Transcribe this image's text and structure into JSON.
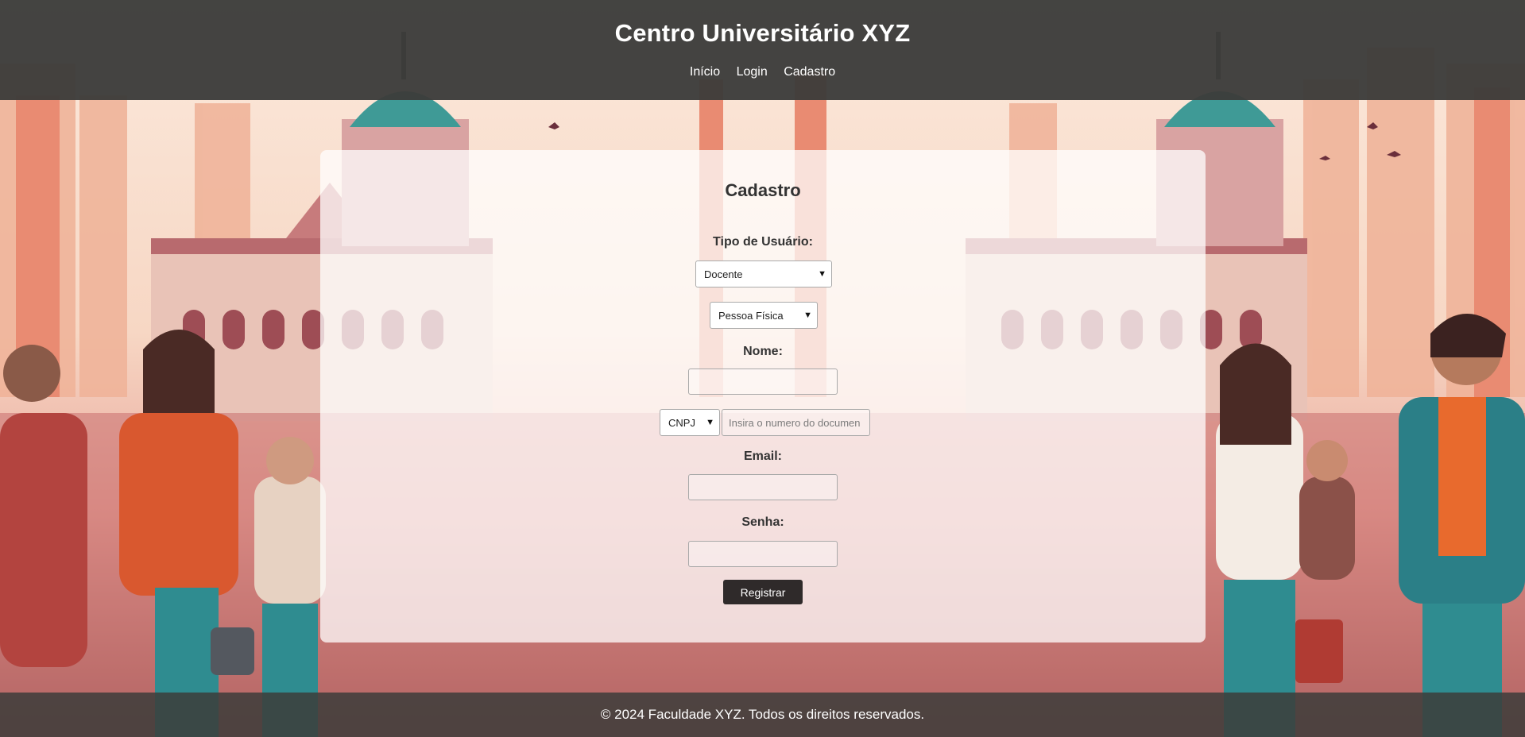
{
  "header": {
    "title": "Centro Universitário XYZ",
    "nav": [
      "Início",
      "Login",
      "Cadastro"
    ]
  },
  "form": {
    "title": "Cadastro",
    "user_type_label": "Tipo de Usuário:",
    "user_type_value": "Docente",
    "person_type_value": "Pessoa Física",
    "name_label": "Nome:",
    "name_value": "",
    "doc_type_value": "CNPJ",
    "doc_number_placeholder": "Insira o numero do documen",
    "email_label": "Email:",
    "email_value": "",
    "password_label": "Senha:",
    "password_value": "",
    "submit_label": "Registrar"
  },
  "footer": {
    "text": "© 2024 Faculdade XYZ. Todos os direitos reservados."
  },
  "colors": {
    "header_bg": "#3c3c3a",
    "card_bg": "#ffffff",
    "button_bg": "#2f2a2a",
    "text": "#333333"
  },
  "icons": {
    "select_arrow": "chevron-down-icon"
  }
}
